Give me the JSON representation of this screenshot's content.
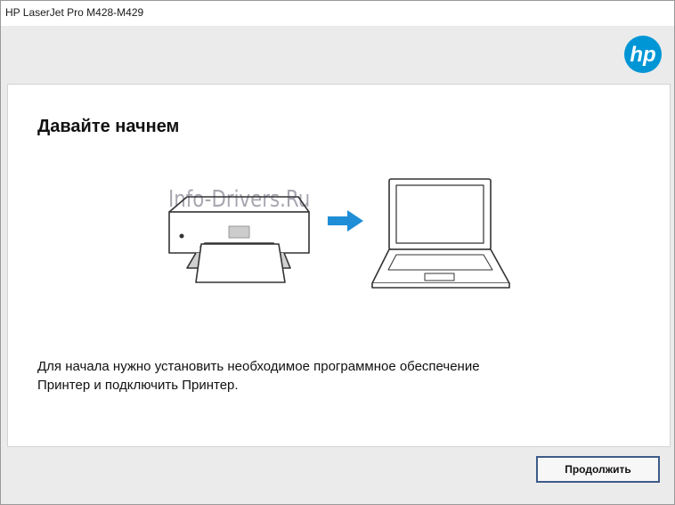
{
  "window": {
    "title": "HP LaserJet Pro M428-M429"
  },
  "brand": {
    "logo_icon": "hp-logo-icon",
    "logo_text": "hp",
    "accent_color": "#0096d6"
  },
  "panel": {
    "heading": "Давайте начнем",
    "watermark": "Info-Drivers.Ru",
    "description": "Для начала нужно установить необходимое программное обеспечение Принтер и подключить Принтер.",
    "illustration": {
      "printer_icon": "printer-icon",
      "arrow_icon": "arrow-right-icon",
      "laptop_icon": "laptop-icon"
    }
  },
  "footer": {
    "continue_label": "Продолжить"
  }
}
